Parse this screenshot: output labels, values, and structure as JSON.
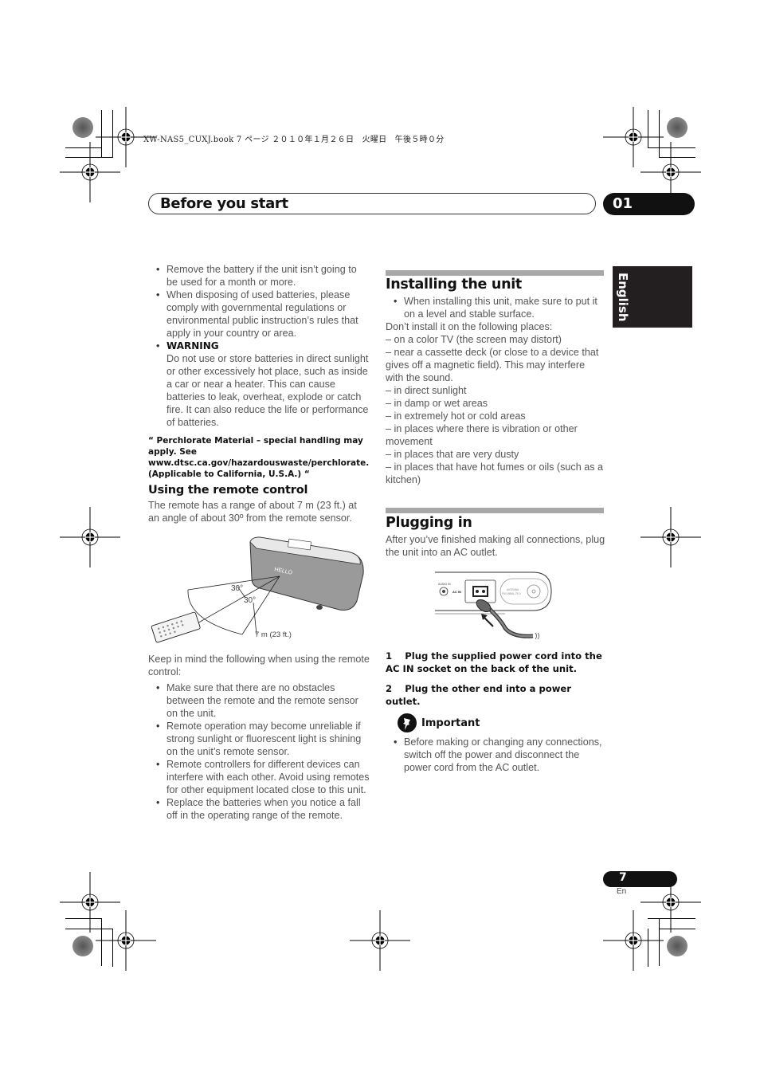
{
  "print_header": "XW-NAS5_CUXJ.book  7 ページ  ２０１０年１月２６日　火曜日　午後５時０分",
  "header": {
    "section_title": "Before you start",
    "chapter_number": "01"
  },
  "language_tab": "English",
  "left_column": {
    "battery_bullets": [
      "Remove the battery if the unit isn’t going to be used for a month or more.",
      "When disposing of used batteries, please comply with governmental regulations or environmental public instruction’s rules that apply in your country or area."
    ],
    "warning": {
      "label": "WARNING",
      "text": "Do not use or store batteries in direct sunlight or other excessively hot place, such as inside a car or near a heater. This can cause batteries to leak, overheat, explode or catch fire. It can also reduce the life or performance of batteries."
    },
    "perchlorate_notice": "“ Perchlorate Material – special handling may apply. See www.dtsc.ca.gov/hazardouswaste/perchlorate. (Applicable to California, U.S.A.) “",
    "remote_section": {
      "heading": "Using the remote control",
      "intro": "The remote has a range of about 7 m (23 ft.) at an angle of about 30º from the remote sensor.",
      "figure": {
        "angle_label_1": "30°",
        "angle_label_2": "30°",
        "range_label": "7 m (23 ft.)",
        "display_text": "HELLO"
      },
      "keep_in_mind": "Keep in mind the following when using the remote control:",
      "bullets": [
        "Make sure that there are no obstacles between the remote and the remote sensor on the unit.",
        "Remote operation may become unreliable if strong sunlight or fluorescent light is shining on the unit’s remote sensor.",
        "Remote controllers for different devices can interfere with each other. Avoid using remotes for other equipment located close to this unit.",
        "Replace the batteries when you notice a fall off in the operating range of the remote."
      ]
    }
  },
  "right_column": {
    "installing": {
      "heading": "Installing the unit",
      "bullet": "When installing this unit, make sure to put it on a level and stable surface.",
      "intro": "Don’t install it on the following places:",
      "places": [
        "– on a color TV (the screen may distort)",
        "– near a cassette deck (or close to a device that gives off a magnetic field). This may interfere with the sound.",
        "– in direct sunlight",
        "– in damp or wet areas",
        "– in extremely hot or cold areas",
        "– in places where there is vibration or other movement",
        "– in places that are very dusty",
        "– in places that have hot fumes or oils (such as a kitchen)"
      ]
    },
    "plugging": {
      "heading": "Plugging in",
      "intro": "After you’ve finished making all connections, plug the unit into an AC outlet.",
      "figure": {
        "audio_in_label": "AUDIO IN",
        "ac_in_label": "AC IN",
        "antenna_label_1": "ANTENNA",
        "antenna_label_2": "FM UNBAL 75 Ω"
      },
      "steps": [
        {
          "number": "1",
          "text": "Plug the supplied power cord into the AC IN socket on the back of the unit."
        },
        {
          "number": "2",
          "text": "Plug the other end into a power outlet."
        }
      ],
      "important": {
        "label": "Important",
        "bullet": "Before making or changing any connections, switch off the power and disconnect the power cord from the AC outlet."
      }
    }
  },
  "footer": {
    "page_number": "7",
    "language_code": "En"
  }
}
